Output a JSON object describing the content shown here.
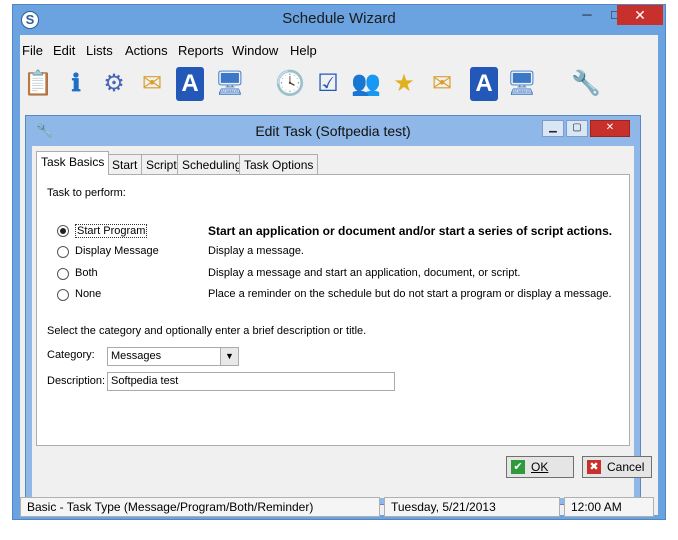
{
  "window": {
    "title": "Schedule Wizard",
    "app_icon_letter": "S",
    "min_glyph": "─",
    "max_glyph": "□",
    "close_glyph": "✕"
  },
  "menu": [
    "File",
    "Edit",
    "Lists",
    "Actions",
    "Reports",
    "Window",
    "Help"
  ],
  "toolbar": [
    {
      "icon": "new-task-icon",
      "glyph": "📋"
    },
    {
      "icon": "info-icon",
      "glyph": "ℹ"
    },
    {
      "icon": "settings-gear-icon",
      "glyph": "⚙"
    },
    {
      "icon": "new-message-icon",
      "glyph": "✉"
    },
    {
      "icon": "new-text-icon",
      "glyph": "A"
    },
    {
      "icon": "new-computer-icon",
      "glyph": "🖥"
    },
    {
      "icon": "clock-icon",
      "glyph": "🕓"
    },
    {
      "icon": "checklist-icon",
      "glyph": "☑"
    },
    {
      "icon": "users-icon",
      "glyph": "👥"
    },
    {
      "icon": "star-icon",
      "glyph": "★"
    },
    {
      "icon": "message-icon",
      "glyph": "✉"
    },
    {
      "icon": "text-icon",
      "glyph": "A"
    },
    {
      "icon": "computer-icon",
      "glyph": "🖥"
    },
    {
      "icon": "tools-icon",
      "glyph": "🔧"
    }
  ],
  "dialog": {
    "title": "Edit Task  (Softpedia test)",
    "tabs": [
      "Task Basics",
      "Start",
      "Script",
      "Scheduling",
      "Task Options"
    ],
    "active_tab": "Task Basics",
    "task_label": "Task to perform:",
    "options": [
      {
        "label": "Start Program",
        "description": "Start an application or document and/or start a series of script actions.",
        "selected": true
      },
      {
        "label": "Display Message",
        "description": "Display a message.",
        "selected": false
      },
      {
        "label": "Both",
        "description": "Display a message and start an application, document, or script.",
        "selected": false
      },
      {
        "label": "None",
        "description": "Place a reminder on the schedule but do not start a program or display a message.",
        "selected": false
      }
    ],
    "category_hint": "Select the category and optionally enter a brief description or title.",
    "category_label": "Category:",
    "category_value": "Messages",
    "description_label": "Description:",
    "description_value": "Softpedia test",
    "ok_label": "OK",
    "cancel_label": "Cancel"
  },
  "status": {
    "task_type": "Basic - Task Type (Message/Program/Both/Reminder)",
    "date": "Tuesday,  5/21/2013",
    "time": "12:00 AM"
  },
  "colors": {
    "frame": "#6aa3e0",
    "child_frame": "#8fb8e8",
    "close_button": "#c7302b",
    "ok_icon": "#2e9a3c",
    "cancel_icon": "#c7302b"
  }
}
